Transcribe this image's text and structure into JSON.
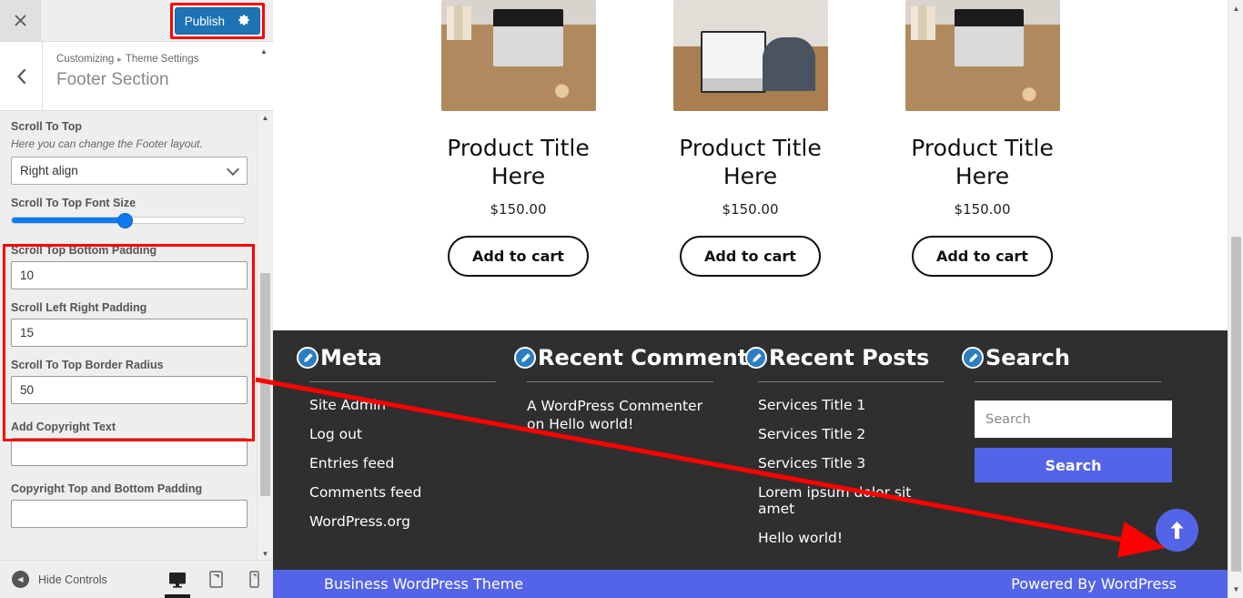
{
  "customizer": {
    "close_icon": "close-icon",
    "publish_label": "Publish",
    "publish_gear_icon": "gear-icon",
    "back_icon": "chevron-left-icon",
    "breadcrumb_root": "Customizing",
    "breadcrumb_sep": "▸",
    "breadcrumb_parent": "Theme Settings",
    "panel_title": "Footer Section",
    "accent_blue": "#1e73b4",
    "highlight_red": "#ff0000",
    "controls": [
      {
        "label": "Scroll To Top",
        "description": "Here you can change the Footer layout.",
        "type": "select",
        "value": "Right align"
      },
      {
        "label": "Scroll To Top Font Size",
        "type": "range",
        "percent": 48
      },
      {
        "label": "Scroll Top Bottom Padding",
        "type": "text",
        "value": "10"
      },
      {
        "label": "Scroll Left Right Padding",
        "type": "text",
        "value": "15"
      },
      {
        "label": "Scroll To Top Border Radius",
        "type": "text",
        "value": "50"
      },
      {
        "label": "Add Copyright Text",
        "type": "text",
        "value": ""
      },
      {
        "label": "Copyright Top and Bottom Padding",
        "type": "text",
        "value": ""
      }
    ],
    "footer": {
      "hide_controls_label": "Hide Controls",
      "hide_icon": "chevron-left-circle-icon",
      "devices": [
        {
          "name": "desktop",
          "icon": "desktop-icon",
          "active": true
        },
        {
          "name": "tablet",
          "icon": "tablet-icon",
          "active": false
        },
        {
          "name": "mobile",
          "icon": "mobile-icon",
          "active": false
        }
      ]
    }
  },
  "preview": {
    "products": [
      {
        "title": "Product Title Here",
        "price": "$150.00",
        "button": "Add to cart",
        "image": "desk-laptop-photo"
      },
      {
        "title": "Product Title Here",
        "price": "$150.00",
        "button": "Add to cart",
        "image": "person-typing-laptop-photo"
      },
      {
        "title": "Product Title Here",
        "price": "$150.00",
        "button": "Add to cart",
        "image": "desk-laptop-photo"
      }
    ],
    "footer_bg": "#2f2f2f",
    "widgets": [
      {
        "title": "Meta",
        "edit_icon": "edit-pencil-icon",
        "type": "list",
        "items": [
          "Site Admin",
          "Log out",
          "Entries feed",
          "Comments feed",
          "WordPress.org"
        ]
      },
      {
        "title": "Recent Comments",
        "edit_icon": "edit-pencil-icon",
        "type": "comment",
        "text": "A WordPress Commenter on Hello world!"
      },
      {
        "title": "Recent Posts",
        "edit_icon": "edit-pencil-icon",
        "type": "list",
        "items": [
          "Services Title 1",
          "Services Title 2",
          "Services Title 3",
          "Lorem ipsum dolor sit amet",
          "Hello world!"
        ]
      },
      {
        "title": "Search",
        "edit_icon": "edit-pencil-icon",
        "type": "search",
        "placeholder": "Search",
        "button": "Search",
        "button_color": "#5464e8"
      }
    ],
    "scroll_top_icon": "arrow-up-icon",
    "scroll_top_color": "#5464e8",
    "copyright_left": "Business WordPress Theme",
    "copyright_right": "Powered By WordPress",
    "copyright_bg": "#5464e8"
  },
  "annotation": {
    "color": "#ff0000",
    "description": "arrow from highlighted padding controls to the scroll-to-top button"
  }
}
